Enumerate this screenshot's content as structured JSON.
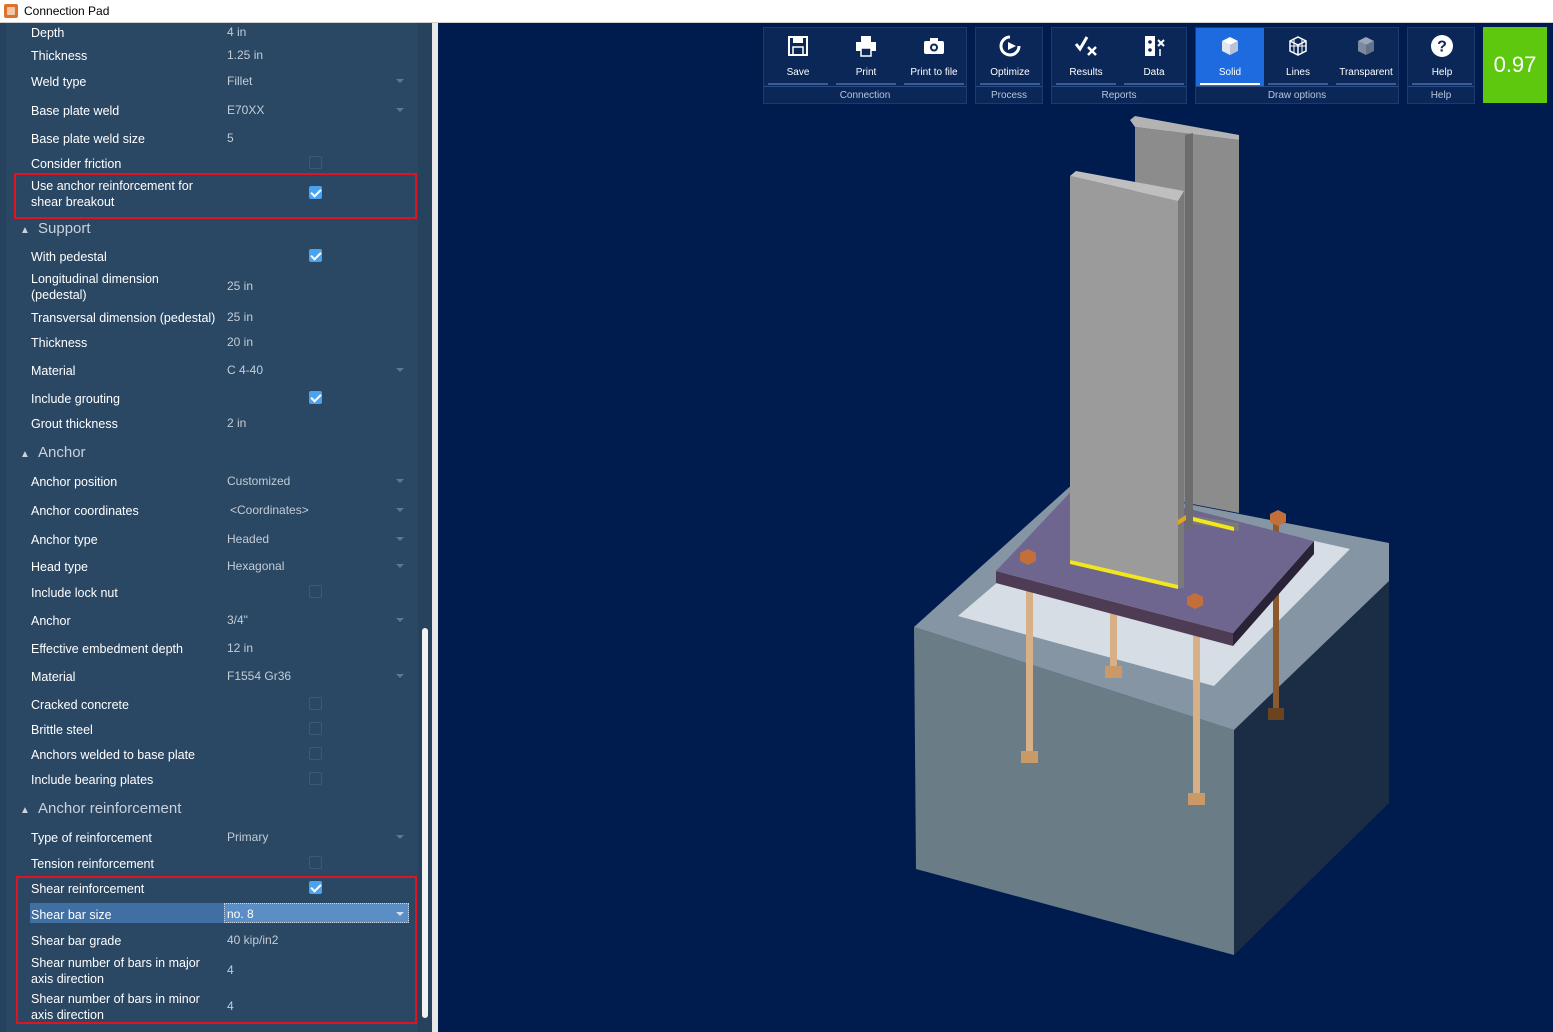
{
  "window": {
    "title": "Connection Pad"
  },
  "properties": {
    "rows_top": [
      {
        "label": "Depth",
        "value": "4 in",
        "control": "text"
      },
      {
        "label": "Thickness",
        "value": "1.25 in",
        "control": "text"
      },
      {
        "label": "Weld type",
        "value": "Fillet",
        "control": "dropdown"
      },
      {
        "label": "Base plate weld",
        "value": "E70XX",
        "control": "dropdown"
      },
      {
        "label": "Base plate weld size",
        "value": "5",
        "control": "text"
      },
      {
        "label": "Consider friction",
        "checked": false,
        "control": "checkbox"
      },
      {
        "label": "Use anchor reinforcement for shear breakout",
        "checked": true,
        "control": "checkbox"
      }
    ],
    "support": {
      "title": "Support",
      "rows": [
        {
          "label": "With pedestal",
          "checked": true,
          "control": "checkbox"
        },
        {
          "label": "Longitudinal dimension (pedestal)",
          "value": "25 in",
          "control": "text"
        },
        {
          "label": "Transversal dimension (pedestal)",
          "value": "25 in",
          "control": "text"
        },
        {
          "label": "Thickness",
          "value": "20 in",
          "control": "text"
        },
        {
          "label": "Material",
          "value": "C 4-40",
          "control": "dropdown"
        },
        {
          "label": "Include grouting",
          "checked": true,
          "control": "checkbox"
        },
        {
          "label": "Grout thickness",
          "value": "2 in",
          "control": "text"
        }
      ]
    },
    "anchor": {
      "title": "Anchor",
      "rows": [
        {
          "label": "Anchor position",
          "value": "Customized",
          "control": "dropdown"
        },
        {
          "label": "Anchor coordinates",
          "value": "<Coordinates>",
          "control": "dropdown"
        },
        {
          "label": "Anchor type",
          "value": "Headed",
          "control": "dropdown"
        },
        {
          "label": "Head type",
          "value": "Hexagonal",
          "control": "dropdown"
        },
        {
          "label": "Include lock nut",
          "checked": false,
          "control": "checkbox"
        },
        {
          "label": "Anchor",
          "value": "3/4\"",
          "control": "dropdown"
        },
        {
          "label": "Effective embedment depth",
          "value": "12 in",
          "control": "text"
        },
        {
          "label": "Material",
          "value": "F1554 Gr36",
          "control": "dropdown"
        },
        {
          "label": "Cracked concrete",
          "checked": false,
          "control": "checkbox"
        },
        {
          "label": "Brittle steel",
          "checked": false,
          "control": "checkbox"
        },
        {
          "label": "Anchors welded to base plate",
          "checked": false,
          "control": "checkbox"
        },
        {
          "label": "Include bearing plates",
          "checked": false,
          "control": "checkbox"
        }
      ]
    },
    "reinforcement": {
      "title": "Anchor reinforcement",
      "rows": [
        {
          "label": "Type of reinforcement",
          "value": "Primary",
          "control": "dropdown"
        },
        {
          "label": "Tension reinforcement",
          "checked": false,
          "control": "checkbox"
        },
        {
          "label": "Shear reinforcement",
          "checked": true,
          "control": "checkbox"
        },
        {
          "label": "Shear bar size",
          "value": "no. 8",
          "control": "dropdown"
        },
        {
          "label": "Shear bar grade",
          "value": "40 kip/in2",
          "control": "text"
        },
        {
          "label": "Shear number of bars in major axis direction",
          "value": "4",
          "control": "text"
        },
        {
          "label": "Shear number of bars in minor axis direction",
          "value": "4",
          "control": "text"
        }
      ]
    }
  },
  "toolbar": {
    "groups": [
      {
        "name": "Connection",
        "buttons": [
          {
            "label": "Save",
            "icon": "save-icon"
          },
          {
            "label": "Print",
            "icon": "print-icon"
          },
          {
            "label": "Print to file",
            "icon": "camera-icon"
          }
        ]
      },
      {
        "name": "Process",
        "buttons": [
          {
            "label": "Optimize",
            "icon": "optimize-icon"
          }
        ]
      },
      {
        "name": "Reports",
        "buttons": [
          {
            "label": "Results",
            "icon": "results-icon"
          },
          {
            "label": "Data",
            "icon": "data-icon"
          }
        ]
      },
      {
        "name": "Draw options",
        "buttons": [
          {
            "label": "Solid",
            "icon": "solid-cube-icon"
          },
          {
            "label": "Lines",
            "icon": "wireframe-cube-icon"
          },
          {
            "label": "Transparent",
            "icon": "transparent-cube-icon"
          }
        ]
      },
      {
        "name": "Help",
        "buttons": [
          {
            "label": "Help",
            "icon": "help-icon"
          }
        ]
      }
    ],
    "active_draw_option": "Solid",
    "score": "0.97"
  },
  "colors": {
    "panel_bg": "#2a4764",
    "viewport_bg": "#001c4f",
    "active_button": "#1e6be0",
    "score_bg": "#5ec80f",
    "highlight_box": "#e0141e"
  }
}
